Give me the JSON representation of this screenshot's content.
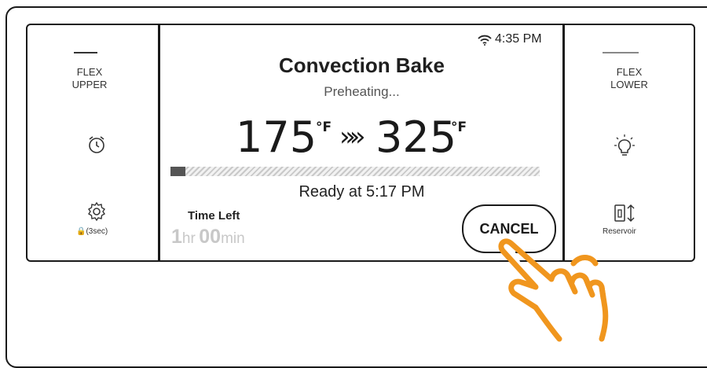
{
  "left_panel": {
    "flex_label": "FLEX\nUPPER",
    "timer_icon": "alarm-clock-icon",
    "settings_icon": "gear-icon",
    "lock_caption": "🔒(3sec)"
  },
  "right_panel": {
    "flex_label": "FLEX\nLOWER",
    "light_icon": "light-bulb-icon",
    "reservoir_icon": "reservoir-icon",
    "reservoir_label": "Reservoir"
  },
  "status": {
    "wifi_icon": "wifi-icon",
    "time": "4:35 PM"
  },
  "main": {
    "mode": "Convection Bake",
    "status_text": "Preheating...",
    "current_temp": "175",
    "target_temp": "325",
    "temp_unit": "°F",
    "arrows": "»»",
    "progress_fraction": 0.04,
    "ready_text": "Ready at 5:17 PM",
    "time_left_label": "Time Left",
    "time_left": {
      "hours": "1",
      "hours_unit": "hr",
      "minutes": "00",
      "minutes_unit": "min"
    },
    "cancel_label": "CANCEL"
  },
  "colors": {
    "hand": "#f0961e",
    "line": "#1a1a1a"
  }
}
